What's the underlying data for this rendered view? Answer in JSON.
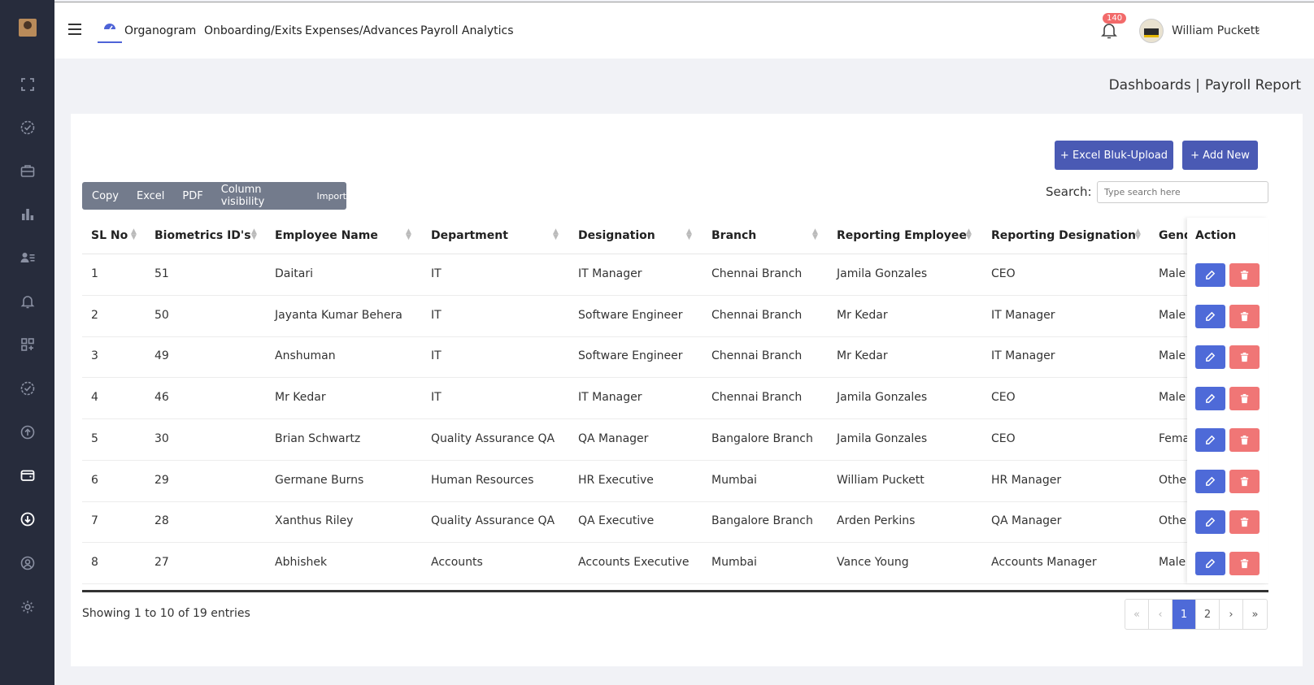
{
  "nav": {
    "items": [
      "Organogram",
      "Onboarding/Exits",
      "Expenses/Advances",
      "Payroll Analytics"
    ],
    "notification_count": "140",
    "user_name": "William Puckett"
  },
  "sidebar_icons": [
    "fullscreen-icon",
    "check-badge-icon",
    "briefcase-icon",
    "bar-chart-icon",
    "users-list-icon",
    "bell-icon",
    "apps-add-icon",
    "verified-icon",
    "upload-circle-icon",
    "wallet-icon",
    "download-circle-icon",
    "user-circle-icon",
    "settings-icon"
  ],
  "breadcrumb": {
    "parent": "Dashboards |",
    "current": "Payroll Report"
  },
  "buttons": {
    "bulk_upload": "+ Excel Bluk-Upload",
    "add_new": "+ Add New"
  },
  "export_buttons": [
    "Copy",
    "Excel",
    "PDF",
    "Column visibility",
    "Import"
  ],
  "search": {
    "label": "Search:",
    "placeholder": "Type search here"
  },
  "table": {
    "headers": [
      "SL No",
      "Biometrics ID's",
      "Employee Name",
      "Department",
      "Designation",
      "Branch",
      "Reporting Employee",
      "Reporting Designation",
      "Gend",
      "Action"
    ],
    "rows": [
      [
        "1",
        "51",
        "Daitari",
        "IT",
        "IT Manager",
        "Chennai Branch",
        "Jamila Gonzales",
        "CEO",
        "Male"
      ],
      [
        "2",
        "50",
        "Jayanta Kumar Behera",
        "IT",
        "Software Engineer",
        "Chennai Branch",
        "Mr Kedar",
        "IT Manager",
        "Male"
      ],
      [
        "3",
        "49",
        "Anshuman",
        "IT",
        "Software Engineer",
        "Chennai Branch",
        "Mr Kedar",
        "IT Manager",
        "Male"
      ],
      [
        "4",
        "46",
        "Mr Kedar",
        "IT",
        "IT Manager",
        "Chennai Branch",
        "Jamila Gonzales",
        "CEO",
        "Male"
      ],
      [
        "5",
        "30",
        "Brian Schwartz",
        "Quality Assurance QA",
        "QA Manager",
        "Bangalore Branch",
        "Jamila Gonzales",
        "CEO",
        "Female"
      ],
      [
        "6",
        "29",
        "Germane Burns",
        "Human Resources",
        "HR Executive",
        "Mumbai",
        "William Puckett",
        "HR Manager",
        "Other"
      ],
      [
        "7",
        "28",
        "Xanthus Riley",
        "Quality Assurance QA",
        "QA Executive",
        "Bangalore Branch",
        "Arden Perkins",
        "QA Manager",
        "Other"
      ],
      [
        "8",
        "27",
        "Abhishek",
        "Accounts",
        "Accounts Executive",
        "Mumbai",
        "Vance Young",
        "Accounts Manager",
        "Male"
      ]
    ]
  },
  "footer": {
    "showing": "Showing 1 to 10 of 19 entries"
  },
  "pagination": [
    "«",
    "‹",
    "1",
    "2",
    "›",
    "»"
  ],
  "colors": {
    "sidebar": "#272c3c",
    "primary": "#4a5ab4",
    "edit": "#4e6ad8",
    "delete": "#f07676"
  }
}
